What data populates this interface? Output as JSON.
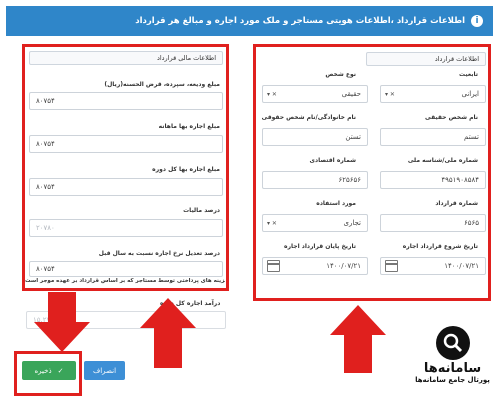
{
  "header": {
    "title": "اطلاعات قرارداد ،اطلاعات هویتی مستاجر و ملک مورد اجاره و مبالغ هر قرارداد"
  },
  "left_panel": {
    "section_title": "اطلاعات مالی قرارداد",
    "fields": [
      {
        "label": "مبلغ ودیعه، سپرده، قرض الحسنه(ریال)",
        "value": "۸۰۷۵۴"
      },
      {
        "label": "مبلغ اجاره بها ماهانه",
        "value": "۸۰۷۵۴"
      },
      {
        "label": "مبلغ اجاره بها کل دوره",
        "value": "۸۰۷۵۴"
      },
      {
        "label": "درصد مالیات",
        "value": "",
        "placeholder": "۲۰۷۸۰"
      },
      {
        "label": "درصد تعدیل نرخ اجاره نسبت به سال قبل",
        "value": "۸۰۷۵۴"
      },
      {
        "label": "هزینه های پرداختی توسط مستاجر که بر اساس قرارداد بر عهده موجر است",
        "value": "۸۰۷۵۴"
      }
    ]
  },
  "below_left": {
    "label": "درآمد اجاره کل دوره",
    "placeholder": "۱۵.۲۷۰"
  },
  "right_panel": {
    "section_title": "اطلاعات قرارداد",
    "nationality": {
      "label": "تابعیت",
      "value": "ایرانی"
    },
    "person_type": {
      "label": "نوع شخص",
      "value": "حقیقی"
    },
    "name": {
      "label": "نام شخص حقیقی",
      "value": "تستم"
    },
    "family": {
      "label": "نام خانوادگی/نام شخص حقوقی",
      "value": "تستن"
    },
    "national_id": {
      "label": "شماره ملی/شناسه ملی",
      "value": "۴۹۵۱۹۰۸۵۸۴"
    },
    "economic_code": {
      "label": "شماره اقتصادی",
      "value": "۶۲۵۶۵۶"
    },
    "contract_no": {
      "label": "شماره قرارداد",
      "value": "۶۵۶۵"
    },
    "usage": {
      "label": "مورد استفاده",
      "value": "تجاری"
    },
    "start_date": {
      "label": "تاریخ شروع قرارداد اجاره",
      "value": "۱۴۰۰/۰۷/۲۱"
    },
    "end_date": {
      "label": "تاریخ پایان قرارداد اجاره",
      "value": "۱۴۰۰/۰۷/۲۱"
    }
  },
  "buttons": {
    "save_label": "ذخیره",
    "cancel_label": "انصراف"
  },
  "logo": {
    "title": "سامانه‌ها",
    "subtitle": "پورتال جامع سامانه‌ها"
  },
  "colors": {
    "header_blue": "#2f86c9",
    "highlight_red": "#e0201e",
    "save_green": "#3aa55a",
    "cancel_blue": "#3d8fd6"
  }
}
